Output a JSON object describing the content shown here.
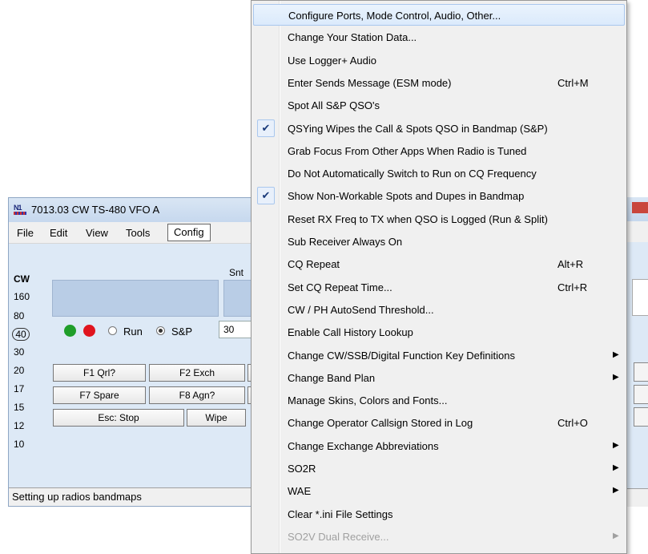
{
  "window": {
    "title": "7013.03 CW TS-480 VFO A",
    "logo": "N1"
  },
  "menubar": [
    "File",
    "Edit",
    "View",
    "Tools",
    "Config"
  ],
  "mode": "CW",
  "bands": [
    "160",
    "80",
    "40",
    "30",
    "20",
    "17",
    "15",
    "12",
    "10"
  ],
  "selected_band": "40",
  "snt_label": "Snt",
  "run_label": "Run",
  "sp_label": "S&P",
  "snt_value": "30",
  "buttons": {
    "f1": "F1 Qrl?",
    "f2": "F2 Exch",
    "f7": "F7 Spare",
    "f8": "F8 Agn?",
    "esc": "Esc: Stop",
    "wipe": "Wipe"
  },
  "status_text": "Setting up radios  bandmaps",
  "menu": [
    {
      "label": "Configure Ports, Mode Control, Audio, Other...",
      "highlighted": true
    },
    {
      "label": "Change Your Station Data..."
    },
    {
      "label": "Use Logger+ Audio"
    },
    {
      "label": "Enter Sends Message (ESM mode)",
      "shortcut": "Ctrl+M"
    },
    {
      "label": "Spot All S&P QSO's"
    },
    {
      "label": "QSYing Wipes the Call & Spots QSO in Bandmap (S&P)",
      "checked": true
    },
    {
      "label": "Grab Focus From Other Apps When Radio is Tuned"
    },
    {
      "label": "Do Not Automatically Switch to Run on CQ Frequency"
    },
    {
      "label": "Show Non-Workable Spots and Dupes in Bandmap",
      "checked": true
    },
    {
      "label": "Reset RX Freq to TX when QSO is Logged (Run & Split)"
    },
    {
      "label": "Sub Receiver Always On"
    },
    {
      "label": "CQ Repeat",
      "shortcut": "Alt+R"
    },
    {
      "label": "Set CQ Repeat Time...",
      "shortcut": "Ctrl+R"
    },
    {
      "label": "CW / PH AutoSend Threshold..."
    },
    {
      "label": "Enable Call History Lookup"
    },
    {
      "label": "Change CW/SSB/Digital Function Key Definitions",
      "submenu": true
    },
    {
      "label": "Change Band Plan",
      "submenu": true
    },
    {
      "label": "Manage Skins, Colors and Fonts..."
    },
    {
      "label": "Change Operator Callsign Stored in Log",
      "shortcut": "Ctrl+O"
    },
    {
      "label": "Change Exchange Abbreviations",
      "submenu": true
    },
    {
      "label": "SO2R",
      "submenu": true
    },
    {
      "label": "WAE",
      "submenu": true
    },
    {
      "label": "Clear *.ini File Settings"
    },
    {
      "label": "SO2V Dual Receive...",
      "submenu": true,
      "disabled": true
    }
  ],
  "icons": {
    "check": "check-icon",
    "submenu": "chevron-right-icon"
  },
  "colors": {
    "green_dot": "#1f9e2a",
    "red_dot": "#e0141e",
    "highlight": "#dbeafc"
  }
}
